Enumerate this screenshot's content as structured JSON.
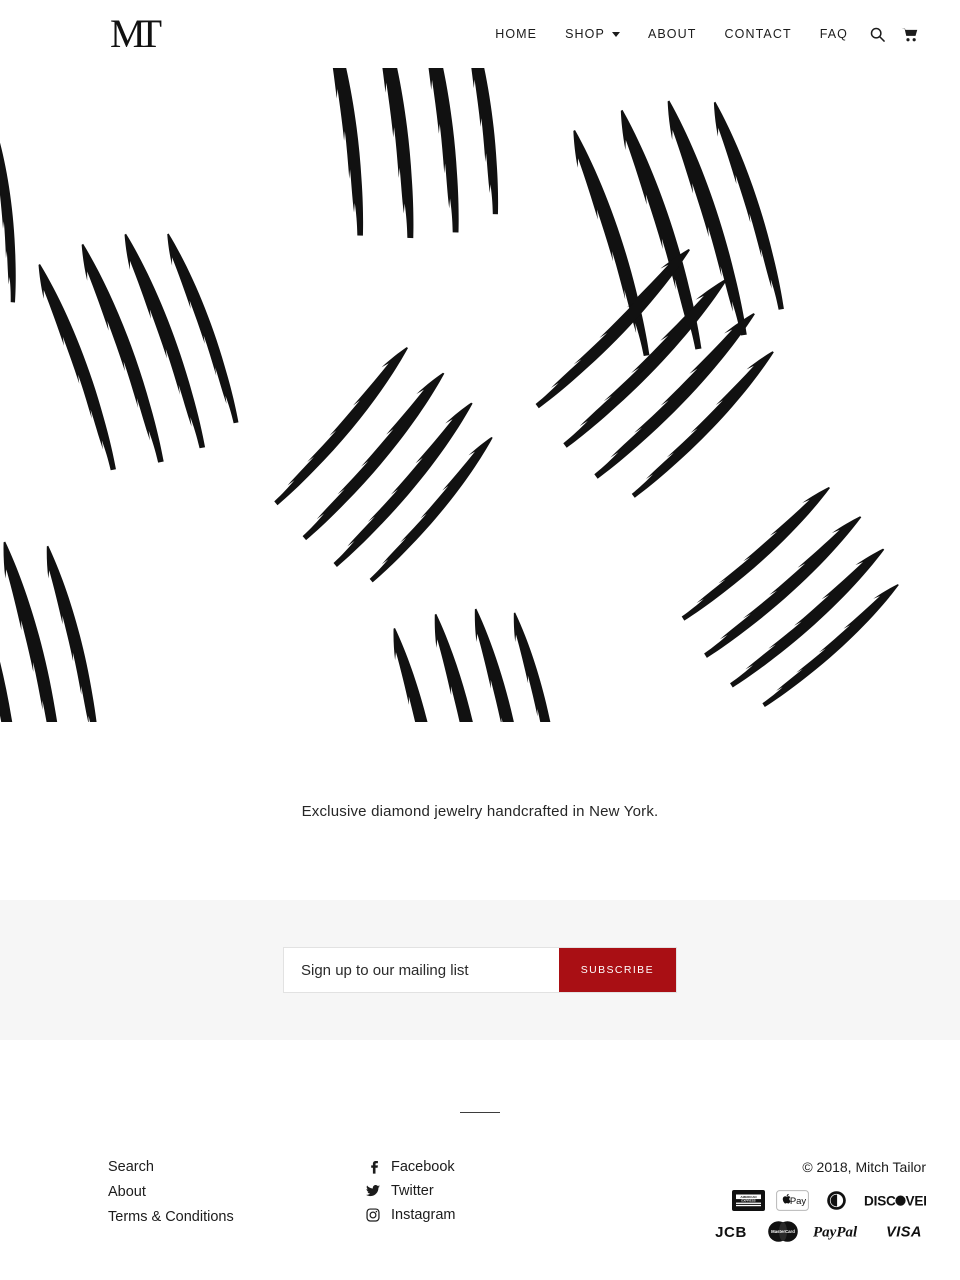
{
  "header": {
    "logo_text": "MT",
    "logo_name": "mitch-tailor-logo",
    "nav": [
      {
        "label": "HOME",
        "name": "nav-home",
        "has_caret": false
      },
      {
        "label": "SHOP",
        "name": "nav-shop",
        "has_caret": true
      },
      {
        "label": "ABOUT",
        "name": "nav-about",
        "has_caret": false
      },
      {
        "label": "CONTACT",
        "name": "nav-contact",
        "has_caret": false
      },
      {
        "label": "FAQ",
        "name": "nav-faq",
        "has_caret": false
      }
    ],
    "icons": [
      {
        "name": "search-icon",
        "label": "Search"
      },
      {
        "name": "cart-icon",
        "label": "Cart"
      }
    ]
  },
  "hero": {
    "image_name": "claw-marks-banner",
    "description": "Black claw scratch marks on white background"
  },
  "tagline": {
    "text": "Exclusive diamond jewelry handcrafted in New York."
  },
  "newsletter": {
    "placeholder": "Sign up to our mailing list",
    "value": "",
    "button_label": "SUBSCRIBE",
    "button_color": "#a90f14",
    "background_color": "#f6f6f6"
  },
  "footer": {
    "links": [
      {
        "label": "Search",
        "name": "footer-link-search"
      },
      {
        "label": "About",
        "name": "footer-link-about"
      },
      {
        "label": "Terms & Conditions",
        "name": "footer-link-terms"
      }
    ],
    "social": [
      {
        "label": "Facebook",
        "icon": "facebook-icon",
        "name": "social-link-facebook"
      },
      {
        "label": "Twitter",
        "icon": "twitter-icon",
        "name": "social-link-twitter"
      },
      {
        "label": "Instagram",
        "icon": "instagram-icon",
        "name": "social-link-instagram"
      }
    ],
    "copyright": "© 2018, Mitch Tailor",
    "payment_methods": [
      [
        "american-express",
        "apple-pay",
        "diners-club",
        "discover"
      ],
      [
        "jcb",
        "mastercard",
        "paypal",
        "visa"
      ]
    ],
    "payment_labels": {
      "american_express": "AMERICAN EXPRESS",
      "apple_pay": "Pay",
      "diners_club": "Diners Club",
      "discover": "DISC VER",
      "jcb": "JCB",
      "mastercard": "MasterCard",
      "paypal": "PayPal",
      "visa": "VISA"
    }
  }
}
